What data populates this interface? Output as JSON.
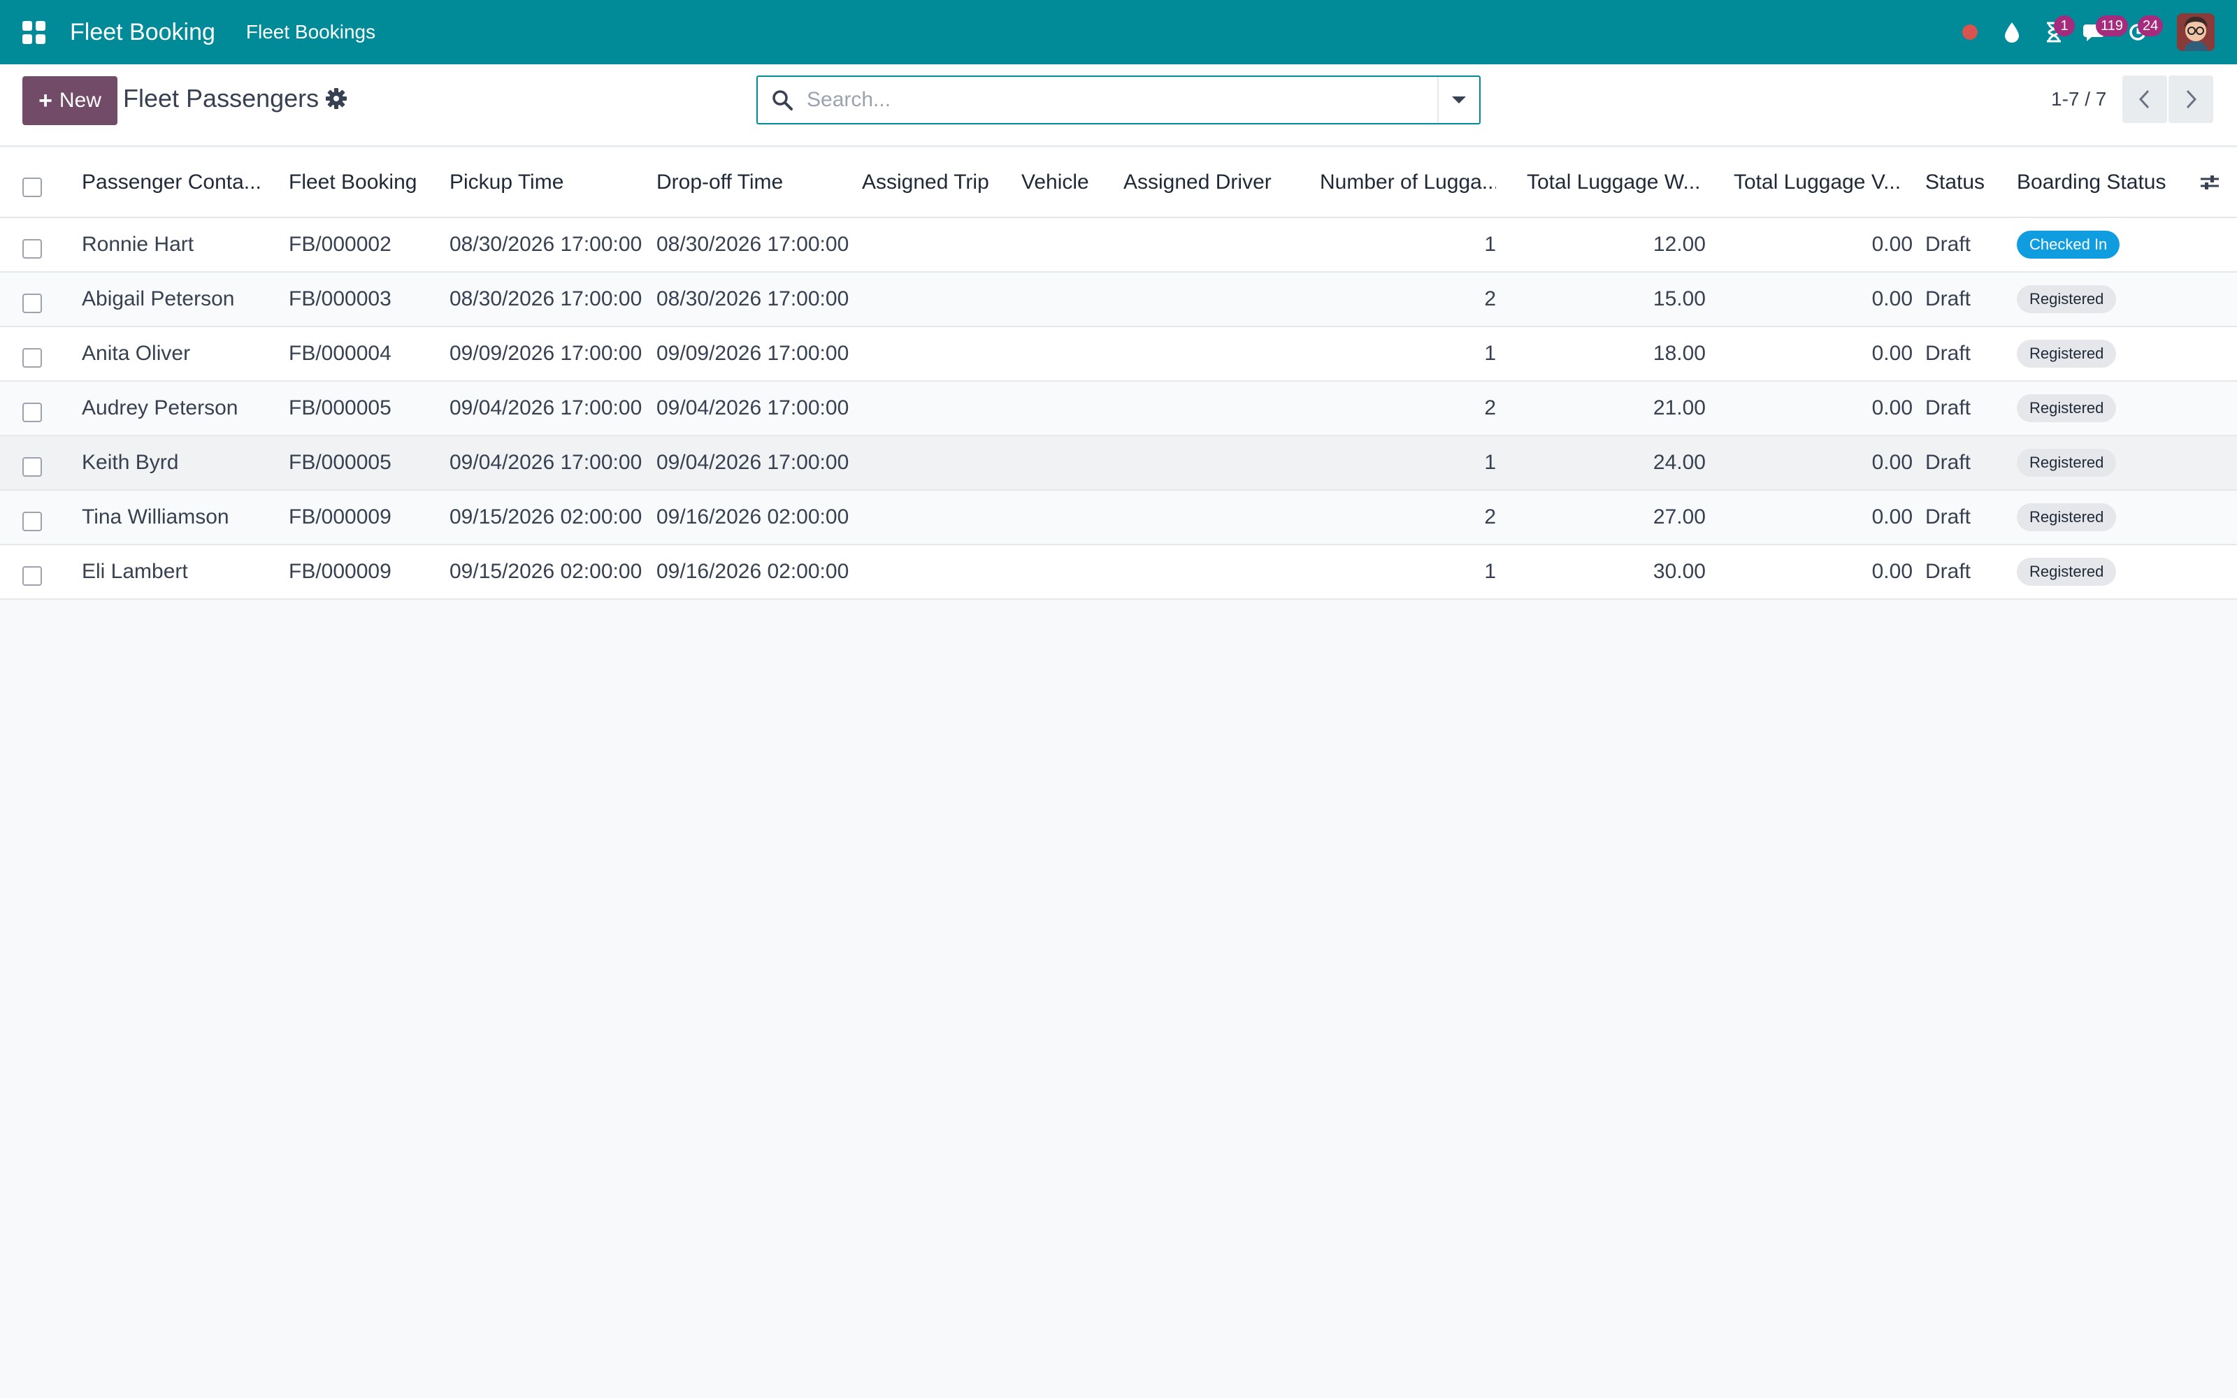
{
  "navbar": {
    "app_name": "Fleet Booking",
    "menu_item": "Fleet Bookings",
    "icons": [
      "apps-grid-icon",
      "record-dot-icon",
      "drop-icon",
      "hourglass-icon",
      "chat-icon",
      "clock-refresh-icon",
      "user-avatar"
    ],
    "badges": {
      "activities": "1",
      "messages": "119",
      "reminders": "24"
    },
    "colors": {
      "bar": "#018a98",
      "badge": "#a52b7c",
      "record": "#d9534f"
    }
  },
  "control": {
    "new_label": "New",
    "title": "Fleet Passengers",
    "search_placeholder": "Search...",
    "pager": "1-7 / 7",
    "colors": {
      "primary": "#714b67"
    }
  },
  "list": {
    "columns": [
      "Passenger Conta...",
      "Fleet Booking",
      "Pickup Time",
      "Drop-off Time",
      "Assigned Trip",
      "Vehicle",
      "Assigned Driver",
      "Number of Lugga...",
      "Total Luggage W...",
      "Total Luggage V...",
      "Status",
      "Boarding Status"
    ],
    "rows": [
      {
        "passenger": "Ronnie Hart",
        "booking": "FB/000002",
        "pickup": "08/30/2026 17:00:00",
        "dropoff": "08/30/2026 17:00:00",
        "trip": "",
        "vehicle": "",
        "driver": "",
        "luggage_count": "1",
        "luggage_weight": "12.00",
        "luggage_volume": "0.00",
        "status": "Draft",
        "boarding": "Checked In"
      },
      {
        "passenger": "Abigail Peterson",
        "booking": "FB/000003",
        "pickup": "08/30/2026 17:00:00",
        "dropoff": "08/30/2026 17:00:00",
        "trip": "",
        "vehicle": "",
        "driver": "",
        "luggage_count": "2",
        "luggage_weight": "15.00",
        "luggage_volume": "0.00",
        "status": "Draft",
        "boarding": "Registered"
      },
      {
        "passenger": "Anita Oliver",
        "booking": "FB/000004",
        "pickup": "09/09/2026 17:00:00",
        "dropoff": "09/09/2026 17:00:00",
        "trip": "",
        "vehicle": "",
        "driver": "",
        "luggage_count": "1",
        "luggage_weight": "18.00",
        "luggage_volume": "0.00",
        "status": "Draft",
        "boarding": "Registered"
      },
      {
        "passenger": "Audrey Peterson",
        "booking": "FB/000005",
        "pickup": "09/04/2026 17:00:00",
        "dropoff": "09/04/2026 17:00:00",
        "trip": "",
        "vehicle": "",
        "driver": "",
        "luggage_count": "2",
        "luggage_weight": "21.00",
        "luggage_volume": "0.00",
        "status": "Draft",
        "boarding": "Registered"
      },
      {
        "passenger": "Keith Byrd",
        "booking": "FB/000005",
        "pickup": "09/04/2026 17:00:00",
        "dropoff": "09/04/2026 17:00:00",
        "trip": "",
        "vehicle": "",
        "driver": "",
        "luggage_count": "1",
        "luggage_weight": "24.00",
        "luggage_volume": "0.00",
        "status": "Draft",
        "boarding": "Registered"
      },
      {
        "passenger": "Tina Williamson",
        "booking": "FB/000009",
        "pickup": "09/15/2026 02:00:00",
        "dropoff": "09/16/2026 02:00:00",
        "trip": "",
        "vehicle": "",
        "driver": "",
        "luggage_count": "2",
        "luggage_weight": "27.00",
        "luggage_volume": "0.00",
        "status": "Draft",
        "boarding": "Registered"
      },
      {
        "passenger": "Eli Lambert",
        "booking": "FB/000009",
        "pickup": "09/15/2026 02:00:00",
        "dropoff": "09/16/2026 02:00:00",
        "trip": "",
        "vehicle": "",
        "driver": "",
        "luggage_count": "1",
        "luggage_weight": "30.00",
        "luggage_volume": "0.00",
        "status": "Draft",
        "boarding": "Registered"
      }
    ],
    "pill_colors": {
      "Checked In": "#0f9de0",
      "Registered": "#e5e7eb"
    }
  }
}
